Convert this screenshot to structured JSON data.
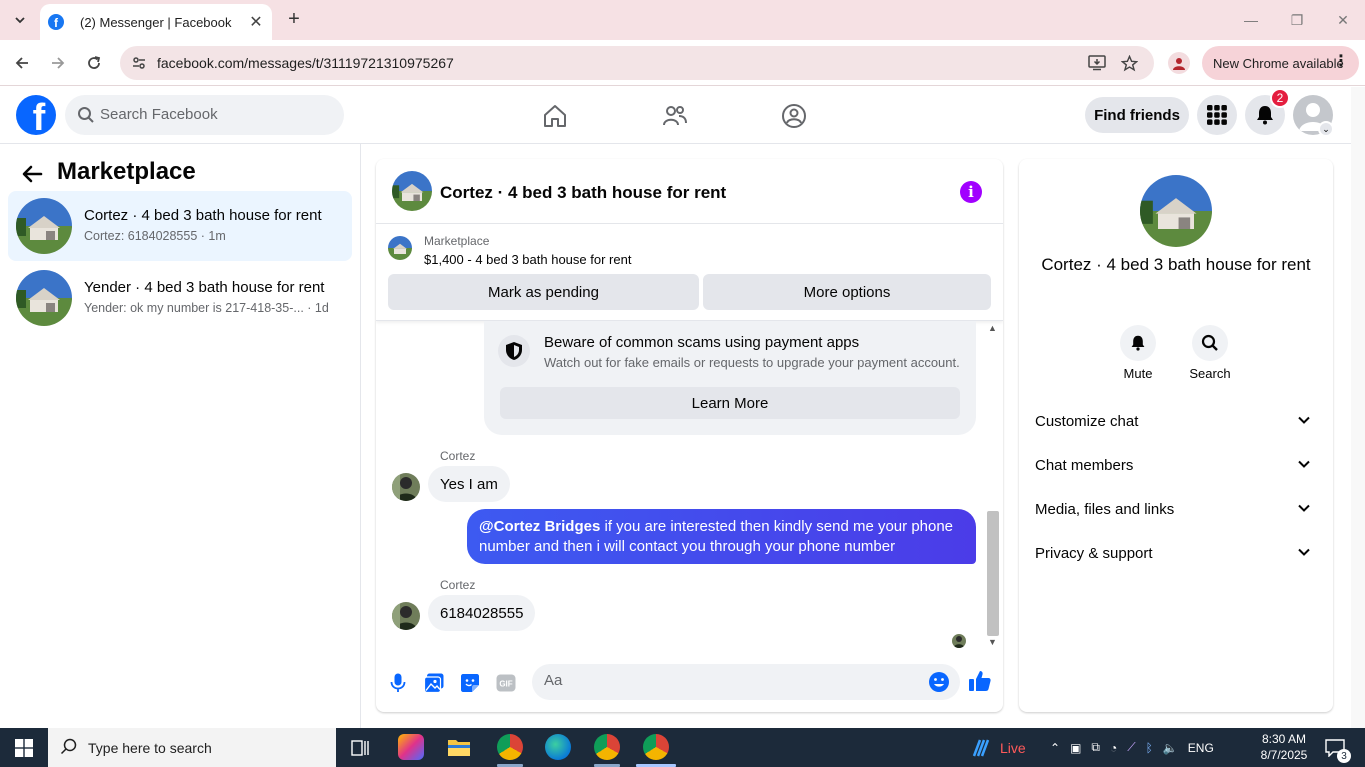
{
  "browser": {
    "tab_title": "(2) Messenger | Facebook",
    "url": "facebook.com/messages/t/31119721310975267",
    "update_chip": "New Chrome available"
  },
  "fb": {
    "search_placeholder": "Search Facebook",
    "find_friends": "Find friends",
    "notification_count": "2"
  },
  "left": {
    "title": "Marketplace",
    "conversations": [
      {
        "name": "Cortez · 4 bed 3 bath house for rent",
        "snippet": "Cortez: 6184028555 · 1m",
        "active": true
      },
      {
        "name": "Yender · 4 bed 3 bath house for rent",
        "snippet": "Yender: ok my number is 217-418-35-... · 1d",
        "active": false
      }
    ]
  },
  "chat": {
    "title": "Cortez · 4 bed 3 bath house for rent",
    "marketplace_label": "Marketplace",
    "listing": "$1,400 - 4 bed 3 bath house for rent",
    "mark_pending": "Mark as pending",
    "more_options": "More options",
    "scam_title": "Beware of common scams using payment apps",
    "scam_text": "Watch out for fake emails or requests to upgrade your payment account.",
    "learn_more": "Learn More",
    "messages": [
      {
        "sender": "Cortez",
        "text": "Yes I am"
      },
      {
        "mention": "@Cortez Bridges",
        "text": " if you are interested then kindly send me your phone number and then i will contact you through your phone number"
      },
      {
        "sender": "Cortez",
        "text": "6184028555"
      }
    ],
    "composer_placeholder": "Aa"
  },
  "info": {
    "name": "Cortez · 4 bed 3 bath house for rent",
    "mute": "Mute",
    "search": "Search",
    "sections": [
      "Customize chat",
      "Chat members",
      "Media, files and links",
      "Privacy & support"
    ]
  },
  "taskbar": {
    "search_placeholder": "Type here to search",
    "live": "Live",
    "lang": "ENG",
    "time": "8:30 AM",
    "date": "8/7/2025",
    "notif": "3"
  },
  "colors": {
    "fb_blue": "#0866ff",
    "bubble_out": "#4a3af5",
    "info_purple": "#a100ff",
    "badge_red": "#e41e3f"
  }
}
